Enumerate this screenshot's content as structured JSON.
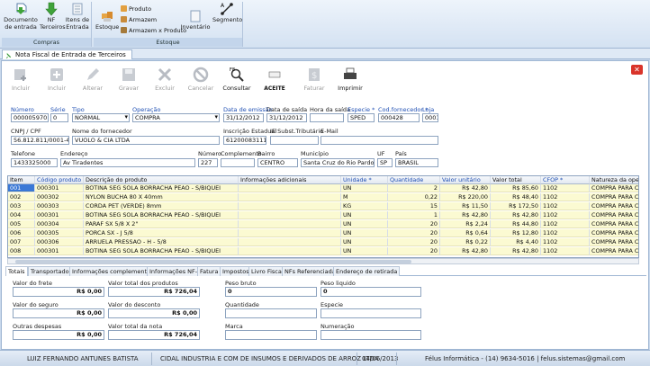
{
  "ribbon": {
    "groups": [
      {
        "title": "Compras",
        "buttons": [
          "Documento de entrada",
          "NF Terceiros",
          "Itens de Entrada"
        ]
      },
      {
        "title": "Estoque",
        "buttons": [
          "Estoque"
        ],
        "small": [
          "Produto",
          "Armazem",
          "Armazem x Produto"
        ],
        "more": [
          "Inventário",
          "Segmento"
        ]
      }
    ],
    "documento": "Documento\nde entrada",
    "nf": "NF\nTerceiros",
    "itens": "Itens de\nEntrada",
    "compras": "Compras",
    "estoque_btn": "Estoque",
    "produto": "Produto",
    "armazem": "Armazem",
    "armazem_produto": "Armazem x Produto",
    "inventario": "Inventário",
    "segmento": "Segmento",
    "estoque_group": "Estoque"
  },
  "tab": {
    "title": "Nota Fiscal de Entrada de Terceiros"
  },
  "toolbar": {
    "incluir": "Incluir",
    "incluir2": "Incluir",
    "alterar": "Alterar",
    "gravar": "Gravar",
    "excluir": "Excluir",
    "cancelar": "Cancelar",
    "consultar": "Consultar",
    "aceite": "ACEITE",
    "faturar": "Faturar",
    "imprimir": "Imprimir"
  },
  "form": {
    "numero_lbl": "Número",
    "numero": "000005970",
    "serie_lbl": "Série",
    "serie": "0",
    "tipo_lbl": "Tipo",
    "tipo": "NORMAL",
    "operacao_lbl": "Operação",
    "operacao": "COMPRA",
    "emissao_lbl": "Data de emissão",
    "emissao": "31/12/2012",
    "saida_lbl": "Data de saída",
    "saida": "31/12/2012",
    "hora_lbl": "Hora da saída",
    "hora": "",
    "especie_lbl": "Especie *",
    "especie": "SPED",
    "codforn_lbl": "Cod.fornecedor *",
    "codforn": "000428",
    "loja_lbl": "Loja",
    "loja": "0001",
    "cnpj_lbl": "CNPJ / CPF",
    "cnpj": "56.812.811/0001-41",
    "nomeforn_lbl": "Nome do fornecedor",
    "nomeforn": "VUOLO & CIA LTDA",
    "ie_lbl": "Inscrição Estadual",
    "ie": "612000831112",
    "iesub_lbl": "IE Subst.Tributário",
    "iesub": "",
    "email_lbl": "E-Mail",
    "email": "",
    "telefone_lbl": "Telefone",
    "telefone": "1433325000",
    "endereco_lbl": "Endereço",
    "endereco": "Av Tiradentes",
    "num_lbl": "Número",
    "num": "227",
    "compl_lbl": "Complemento",
    "compl": "",
    "bairro_lbl": "Bairro",
    "bairro": "CENTRO",
    "municipio_lbl": "Município",
    "municipio": "Santa Cruz do Rio Pardo",
    "uf_lbl": "UF",
    "uf": "SP",
    "pais_lbl": "País",
    "pais": "BRASIL"
  },
  "grid": {
    "headers": [
      "Item",
      "Código produto *",
      "Descrição do produto",
      "Informações adicionais",
      "Unidade *",
      "Quantidade",
      "Valor unitário",
      "Valor total",
      "CFOP *",
      "Natureza da ope"
    ],
    "rows": [
      [
        "001",
        "000301",
        "BOTINA SEG SOLA BORRACHA PEAO - S/BIQUEI",
        "",
        "UN",
        "2",
        "R$ 42,80",
        "R$ 85,60",
        "1102",
        "COMPRA PARA C"
      ],
      [
        "002",
        "000302",
        "NYLON BUCHA 80 X 40mm",
        "",
        "M",
        "0,22",
        "R$ 220,00",
        "R$ 48,40",
        "1102",
        "COMPRA PARA C"
      ],
      [
        "003",
        "000303",
        "CORDA PET (VERDE) 8mm",
        "",
        "KG",
        "15",
        "R$ 11,50",
        "R$ 172,50",
        "1102",
        "COMPRA PARA C"
      ],
      [
        "004",
        "000301",
        "BOTINA SEG SOLA BORRACHA PEAO - S/BIQUEI",
        "",
        "UN",
        "1",
        "R$ 42,80",
        "R$ 42,80",
        "1102",
        "COMPRA PARA C"
      ],
      [
        "005",
        "000304",
        "PARAF SX 5/8 X 2\"",
        "",
        "UN",
        "20",
        "R$ 2,24",
        "R$ 44,80",
        "1102",
        "COMPRA PARA C"
      ],
      [
        "006",
        "000305",
        "PORCA SX - J 5/8",
        "",
        "UN",
        "20",
        "R$ 0,64",
        "R$ 12,80",
        "1102",
        "COMPRA PARA C"
      ],
      [
        "007",
        "000306",
        "ARRUELA PRESSAO - H - 5/8",
        "",
        "UN",
        "20",
        "R$ 0,22",
        "R$ 4,40",
        "1102",
        "COMPRA PARA C"
      ],
      [
        "008",
        "000301",
        "BOTINA SEG SOLA BORRACHA PEAO - S/BIQUEI",
        "",
        "UN",
        "20",
        "R$ 42,80",
        "R$ 42,80",
        "1102",
        "COMPRA PARA C"
      ]
    ]
  },
  "subtabs": [
    "Totais",
    "Transportador",
    "Informações complementares",
    "Informações NF-e",
    "Fatura",
    "Impostos",
    "Livro Fiscal",
    "NFs Referenciadas",
    "Endereço de retirada"
  ],
  "totais": {
    "frete_lbl": "Valor do frete",
    "frete": "R$ 0,00",
    "produtos_lbl": "Valor total dos produtos",
    "produtos": "R$ 726,04",
    "pesobruto_lbl": "Peso bruto",
    "pesobruto": "0",
    "pesoliq_lbl": "Peso liquido",
    "pesoliq": "0",
    "seguro_lbl": "Valor do seguro",
    "seguro": "R$ 0,00",
    "desconto_lbl": "Valor do desconto",
    "desconto": "R$ 0,00",
    "quantidade_lbl": "Quantidade",
    "quantidade": "",
    "especie_lbl": "Especie",
    "especie": "",
    "outras_lbl": "Outras despesas",
    "outras": "R$ 0,00",
    "totalnota_lbl": "Valor total da nota",
    "totalnota": "R$ 726,04",
    "marca_lbl": "Marca",
    "marca": "",
    "numeracao_lbl": "Numeração",
    "numeracao": ""
  },
  "status": {
    "user": "LUIZ FERNANDO ANTUNES BATISTA",
    "company": "CIDAL INDUSTRIA E COM DE INSUMOS E DERIVADOS DE ARROZ LTDA",
    "date": "04/06/2013",
    "contact": "Félus Informática - (14) 9634-5016 | felus.sistemas@gmail.com"
  },
  "colors": {
    "accent": "#1f4fb3",
    "row": "#fbfad2",
    "selected": "#3a78d6",
    "close": "#d9342a"
  }
}
